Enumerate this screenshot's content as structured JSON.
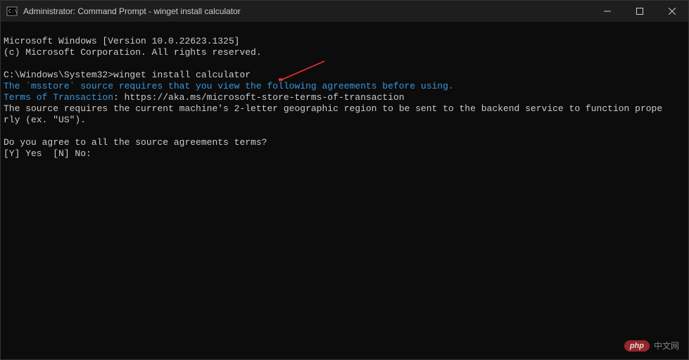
{
  "titlebar": {
    "title": "Administrator: Command Prompt - winget  install calculator"
  },
  "terminal": {
    "line1": "Microsoft Windows [Version 10.0.22623.1325]",
    "line2": "(c) Microsoft Corporation. All rights reserved.",
    "prompt": "C:\\Windows\\System32>",
    "command": "winget install calculator",
    "msg1": "The `msstore` source requires that you view the following agreements before using.",
    "terms_label": "Terms of Transaction",
    "terms_url": ": https://aka.ms/microsoft-store-terms-of-transaction",
    "msg2a": "The source requires the current machine's 2-letter geographic region to be sent to the backend service to function prope",
    "msg2b": "rly (ex. \"US\").",
    "question": "Do you agree to all the source agreements terms?",
    "options": "[Y] Yes  [N] No:"
  },
  "watermark": {
    "badge": "php",
    "text": "中文网"
  }
}
